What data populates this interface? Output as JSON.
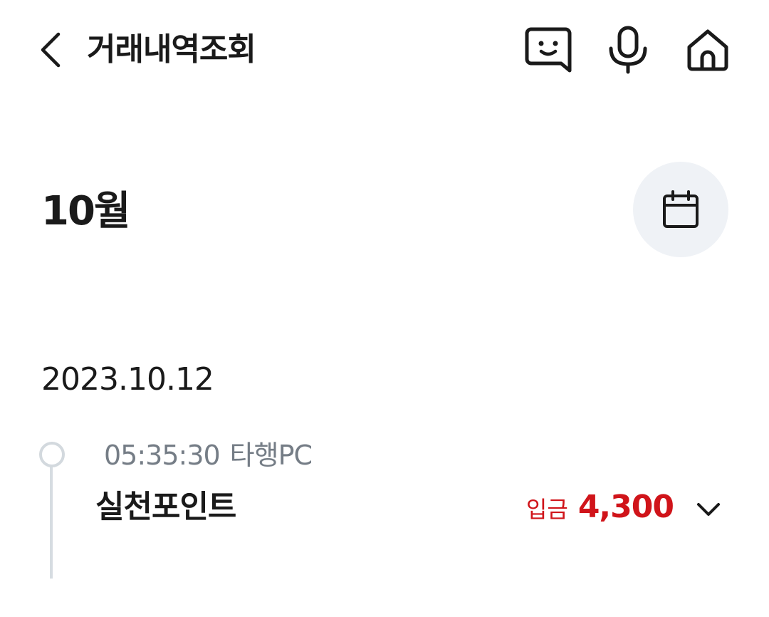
{
  "header": {
    "title": "거래내역조회",
    "back_icon": "chevron-left-icon",
    "actions": [
      {
        "icon": "chat-bot-icon"
      },
      {
        "icon": "microphone-icon"
      },
      {
        "icon": "home-icon"
      }
    ]
  },
  "month": {
    "label": "10월",
    "calendar_icon": "calendar-icon"
  },
  "groups": [
    {
      "date": "2023.10.12",
      "transactions": [
        {
          "time": "05:35:30",
          "bank": "타행PC",
          "name": "실천포인트",
          "type": "입금",
          "amount": "4,300"
        }
      ]
    }
  ],
  "colors": {
    "deposit": "#d0141a",
    "meta_text": "#757d86",
    "calendar_bg": "#eff2f6",
    "timeline": "#d6dce1"
  }
}
